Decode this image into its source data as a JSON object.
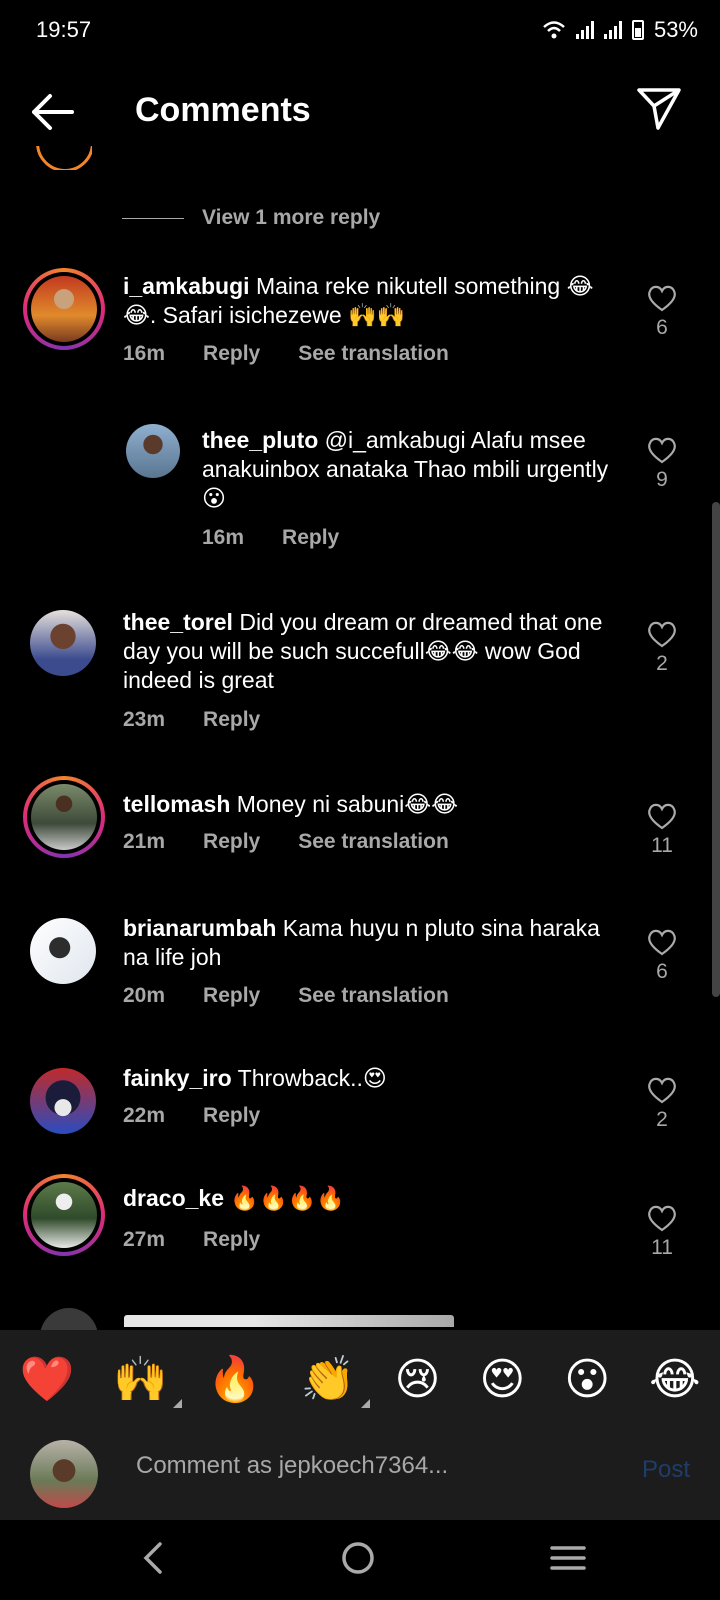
{
  "status_bar": {
    "time": "19:57",
    "battery": "53%"
  },
  "header": {
    "title": "Comments"
  },
  "view_more": "View 1 more reply",
  "comments": [
    {
      "user": "i_amkabugi",
      "text": "Maina reke nikutell something 😂😂. Safari isichezewe 🙌🙌",
      "time": "16m",
      "reply": "Reply",
      "translate": "See translation",
      "likes": "6"
    },
    {
      "user": "thee_pluto",
      "text": "@i_amkabugi Alafu msee anakuinbox anataka Thao mbili urgently😮",
      "time": "16m",
      "reply": "Reply",
      "likes": "9"
    },
    {
      "user": "thee_torel",
      "text": "Did you dream or dreamed that one day you will be such succefull😂😂 wow God indeed is great",
      "time": "23m",
      "reply": "Reply",
      "likes": "2"
    },
    {
      "user": "tellomash",
      "text": "Money ni sabuni😂😂",
      "time": "21m",
      "reply": "Reply",
      "translate": "See translation",
      "likes": "11"
    },
    {
      "user": "brianarumbah",
      "text": "Kama huyu n pluto sina haraka na life joh",
      "time": "20m",
      "reply": "Reply",
      "translate": "See translation",
      "likes": "6"
    },
    {
      "user": "fainky_iro",
      "text": "Throwback..😍",
      "time": "22m",
      "reply": "Reply",
      "likes": "2"
    },
    {
      "user": "draco_ke",
      "text": "🔥🔥🔥🔥",
      "time": "27m",
      "reply": "Reply",
      "likes": "11"
    }
  ],
  "emoji_bar": [
    "❤️",
    "🙌",
    "🔥",
    "👏",
    "😢",
    "😍",
    "😮",
    "😂"
  ],
  "composer": {
    "placeholder": "Comment as jepkoech7364...",
    "post": "Post"
  },
  "colors": {
    "ring_a": "#f58529",
    "ring_b": "#dd2a7b",
    "post_disabled": "#1e3d6b"
  }
}
